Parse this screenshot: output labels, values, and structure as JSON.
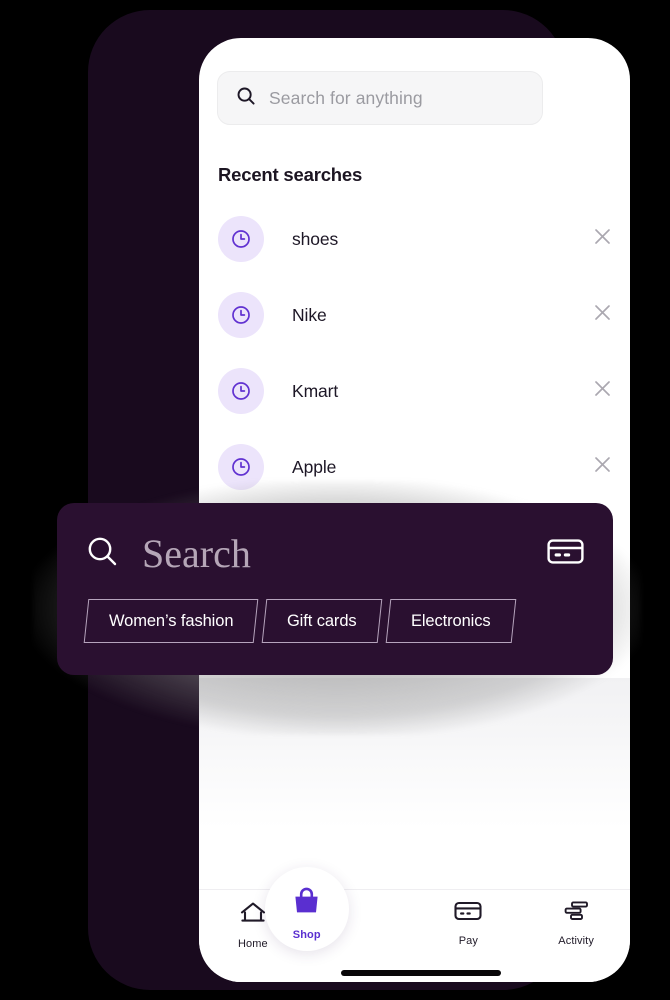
{
  "app": {
    "accent_purple": "#5a2fd0",
    "badge_lavender": "#ece4fb",
    "frame_color": "#190a1e",
    "overlay_bg": "#2a1030"
  },
  "search": {
    "placeholder": "Search for anything",
    "value": "",
    "icon": "search-icon"
  },
  "recent": {
    "heading": "Recent searches",
    "items": [
      {
        "label": "shoes",
        "icon": "clock-icon",
        "remove": "close-icon"
      },
      {
        "label": "Nike",
        "icon": "clock-icon",
        "remove": "close-icon"
      },
      {
        "label": "Kmart",
        "icon": "clock-icon",
        "remove": "close-icon"
      },
      {
        "label": "Apple",
        "icon": "clock-icon",
        "remove": "close-icon"
      }
    ]
  },
  "overlay": {
    "search_word": "Search",
    "search_icon": "search-icon",
    "card_icon": "credit-card-icon",
    "chips": [
      {
        "label": "Women’s fashion"
      },
      {
        "label": "Gift cards"
      },
      {
        "label": "Electronics"
      }
    ]
  },
  "bottom_nav": {
    "items": [
      {
        "label": "Home",
        "icon": "home-icon",
        "active": false
      },
      {
        "label": "Shop",
        "icon": "shopping-bag-icon",
        "active": true
      },
      {
        "label": "Pay",
        "icon": "credit-card-icon",
        "active": false
      },
      {
        "label": "Activity",
        "icon": "activity-bars-icon",
        "active": false
      }
    ]
  }
}
